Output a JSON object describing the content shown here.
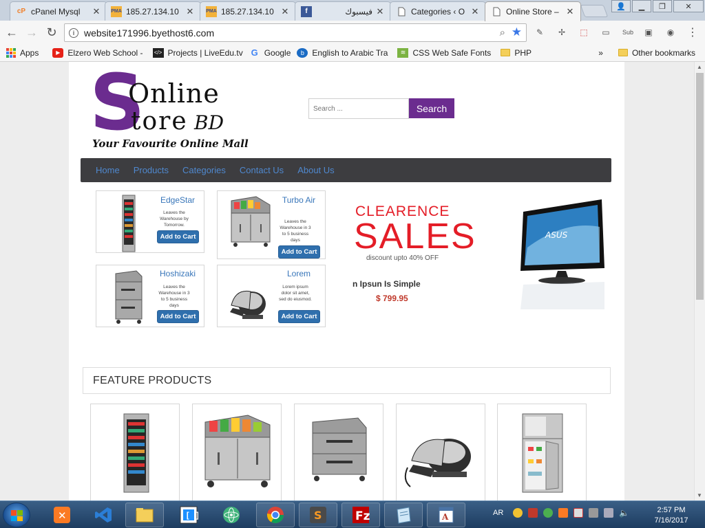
{
  "browser": {
    "tabs": [
      {
        "title": "cPanel Mysql",
        "favicon": "cpanel-icon"
      },
      {
        "title": "185.27.134.10",
        "favicon": "phpmyadmin-icon"
      },
      {
        "title": "185.27.134.10",
        "favicon": "phpmyadmin-icon"
      },
      {
        "title": "فيسبوك",
        "favicon": "facebook-icon"
      },
      {
        "title": "Categories ‹ O",
        "favicon": "page-icon"
      },
      {
        "title": "Online Store –",
        "favicon": "page-icon"
      }
    ],
    "address": "website171996.byethost6.com",
    "bookmarks": [
      {
        "label": "Apps"
      },
      {
        "label": "Elzero Web School -"
      },
      {
        "label": "Projects | LiveEdu.tv"
      },
      {
        "label": "Google"
      },
      {
        "label": "English to Arabic Tra"
      },
      {
        "label": "CSS Web Safe Fonts"
      },
      {
        "label": "PHP"
      },
      {
        "label": "Other bookmarks"
      }
    ],
    "more_bookmarks": "»"
  },
  "site": {
    "logo": {
      "s": "S",
      "online": "Online",
      "tore": "tore",
      "bd": "BD",
      "tagline": "Your Favourite Online Mall"
    },
    "search": {
      "placeholder": "Search ...",
      "button": "Search"
    },
    "nav": [
      "Home",
      "Products",
      "Categories",
      "Contact Us",
      "About Us"
    ],
    "products": [
      {
        "name": "EdgeStar",
        "desc": "Leaves the Warehouse by Tomorrow.",
        "cart": "Add to Cart"
      },
      {
        "name": "Turbo Air",
        "desc": "Leaves the Warehouse in 3 to 5 business days",
        "cart": "Add to Cart"
      },
      {
        "name": "Hoshizaki",
        "desc": "Leaves the Warehouse in 3 to 5 business days",
        "cart": "Add to Cart"
      },
      {
        "name": "Lorem",
        "desc": "Lorem ipsum dolor sit amet, sed do eiusmod.",
        "cart": "Add to Cart"
      }
    ],
    "banner": {
      "line1": "CLEARENCE",
      "line2": "SALES",
      "discount": "discount upto 40% OFF",
      "caption": "n Ipsun Is Simple",
      "price": "$ 799.95",
      "monitor_brand": "ASUS"
    },
    "feature_title": "FEATURE PRODUCTS"
  },
  "taskbar": {
    "lang": "AR",
    "time": "2:57 PM",
    "date": "7/16/2017"
  }
}
